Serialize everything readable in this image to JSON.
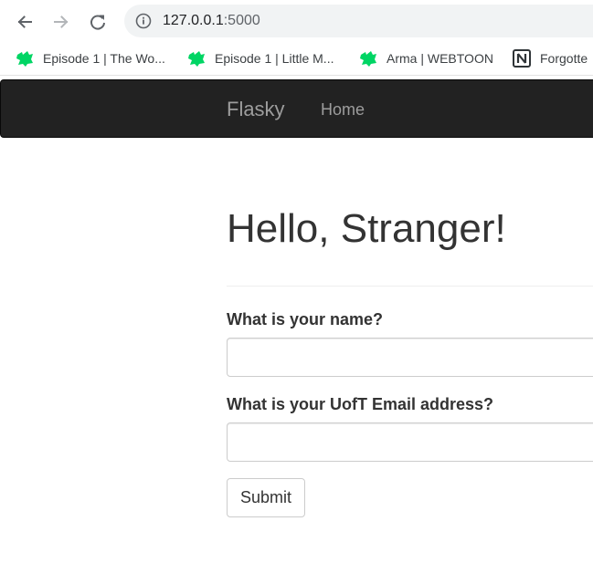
{
  "browser": {
    "url_host": "127.0.0.1",
    "url_port": ":5000",
    "bookmarks": [
      {
        "label": "Episode 1 | The Wo...",
        "icon": "webtoon-icon"
      },
      {
        "label": "Episode 1 | Little M...",
        "icon": "webtoon-icon"
      },
      {
        "label": "Arma | WEBTOON",
        "icon": "webtoon-icon"
      },
      {
        "label": "Forgotte",
        "icon": "notion-icon"
      }
    ]
  },
  "navbar": {
    "brand": "Flasky",
    "links": [
      "Home"
    ]
  },
  "page": {
    "title": "Hello, Stranger!"
  },
  "form": {
    "name_label": "What is your name?",
    "name_value": "",
    "email_label": "What is your UofT Email address?",
    "email_value": "",
    "submit_label": "Submit"
  },
  "colors": {
    "navbar_bg": "#222222",
    "navbar_text": "#9d9d9d",
    "webtoon_green": "#00d564",
    "text": "#333333"
  }
}
